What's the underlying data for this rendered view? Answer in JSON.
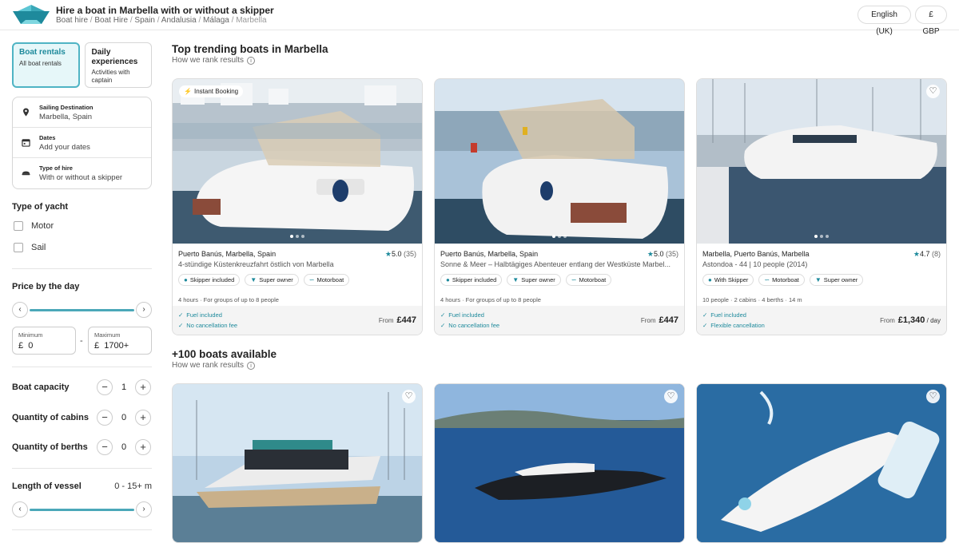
{
  "header": {
    "title": "Hire a boat in Marbella with or without a skipper",
    "breadcrumb": [
      "Boat hire",
      "Boat Hire",
      "Spain",
      "Andalusia",
      "Málaga",
      "Marbella"
    ],
    "language": "English (UK)",
    "currency": "£ GBP"
  },
  "sidebar": {
    "tabs": [
      {
        "title": "Boat rentals",
        "subtitle": "All boat rentals"
      },
      {
        "title": "Daily experiences",
        "subtitle": "Activities with captain"
      }
    ],
    "search": {
      "destination_label": "Sailing Destination",
      "destination_value": "Marbella, Spain",
      "dates_label": "Dates",
      "dates_value": "Add your dates",
      "hire_label": "Type of hire",
      "hire_value": "With or without a skipper"
    },
    "yacht_type": {
      "title": "Type of yacht",
      "options": [
        "Motor",
        "Sail"
      ]
    },
    "price": {
      "title": "Price by the day",
      "min_label": "Minimum",
      "min_currency": "£",
      "min_value": "0",
      "max_label": "Maximum",
      "max_currency": "£",
      "max_value": "1700+",
      "dash": "-"
    },
    "capacity": {
      "label": "Boat capacity",
      "value": "1"
    },
    "cabins": {
      "label": "Quantity of cabins",
      "value": "0"
    },
    "berths": {
      "label": "Quantity of berths",
      "value": "0"
    },
    "length": {
      "label": "Length of vessel",
      "value": "0 - 15+ m"
    }
  },
  "main": {
    "trending_title": "Top trending boats in Marbella",
    "rank_text": "How we rank results",
    "available_title": "+100 boats available",
    "rank_text_2": "How we rank results",
    "instant_booking": "Instant Booking",
    "cards": [
      {
        "location": "Puerto Banús, Marbella, Spain",
        "rating": "5.0",
        "count": "(35)",
        "description": "4-stündige Küstenkreuzfahrt östlich von Marbella",
        "tags": [
          "Skipper included",
          "Super owner",
          "Motorboat"
        ],
        "meta": "4 hours · For groups of up to 8 people",
        "perks": [
          "Fuel included",
          "No cancellation fee"
        ],
        "from": "From",
        "price": "£447",
        "per": ""
      },
      {
        "location": "Puerto Banús, Marbella, Spain",
        "rating": "5.0",
        "count": "(35)",
        "description": "Sonne & Meer – Halbtägiges Abenteuer entlang der Westküste Marbel...",
        "tags": [
          "Skipper included",
          "Super owner",
          "Motorboat"
        ],
        "meta": "4 hours · For groups of up to 8 people",
        "perks": [
          "Fuel included",
          "No cancellation fee"
        ],
        "from": "From",
        "price": "£447",
        "per": ""
      },
      {
        "location": "Marbella, Puerto Banús, Marbella",
        "rating": "4.7",
        "count": "(8)",
        "description": "Astondoa - 44 | 10 people (2014)",
        "tags": [
          "With Skipper",
          "Motorboat",
          "Super owner"
        ],
        "meta": "10 people · 2 cabins · 4 berths · 14 m",
        "perks": [
          "Fuel included",
          "Flexible cancellation"
        ],
        "from": "From",
        "price": "£1,340",
        "per": "/ day"
      }
    ]
  },
  "colors": {
    "accent": "#1e8a9c",
    "slider": "#4ba8b9",
    "active_tab_bg": "#e6f7f9"
  }
}
